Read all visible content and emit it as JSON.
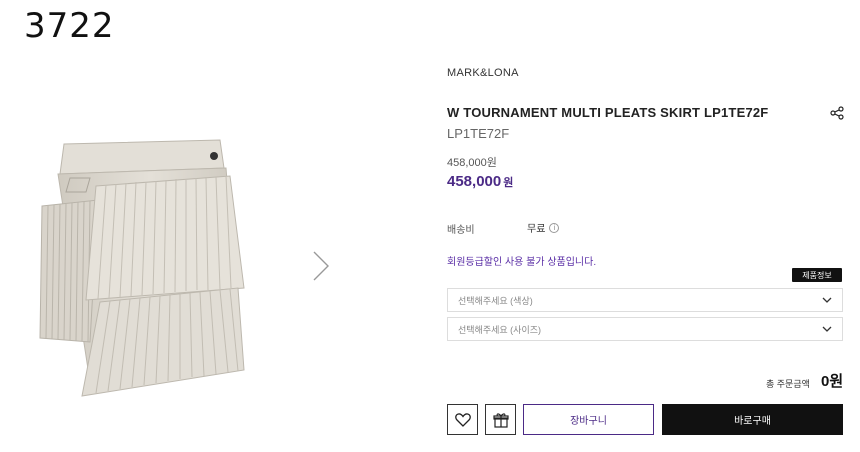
{
  "corner_number": "3722",
  "product": {
    "brand": "MARK&LONA",
    "title": "W TOURNAMENT MULTI PLEATS SKIRT LP1TE72F",
    "model": "LP1TE72F",
    "original_price": "458,000원",
    "sale_price": "458,000",
    "sale_unit": "원"
  },
  "shipping": {
    "label": "배송비",
    "value": "무료",
    "info_icon": "i"
  },
  "member_note": "회원등급할인 사용 불가 상품입니다.",
  "product_info_badge": "제품정보",
  "options": {
    "color_placeholder": "선택해주세요 (색상)",
    "size_placeholder": "선택해주세요 (사이즈)"
  },
  "total": {
    "label": "총 주문금액",
    "value": "0원"
  },
  "buttons": {
    "cart": "장바구니",
    "buy": "바로구매"
  },
  "icons": {
    "share": "share-icon",
    "wish": "heart-icon",
    "gift": "gift-icon",
    "next": "chevron-right-icon",
    "dropdown": "chevron-down-icon"
  },
  "colors": {
    "accent": "#4b2a86",
    "buy_button": "#111111",
    "skirt": "#ddd8cf"
  }
}
